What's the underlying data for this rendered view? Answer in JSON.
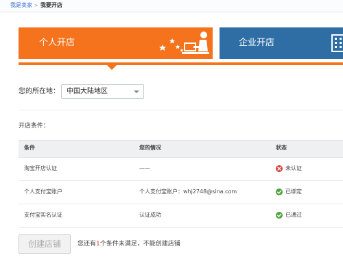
{
  "breadcrumb": {
    "parent": "我是卖家",
    "separator": ">",
    "current": "我要开店"
  },
  "tabs": [
    {
      "label": "个人开店",
      "selected": true,
      "color": "#f5731c",
      "icon": "person-at-desk-icon"
    },
    {
      "label": "企业开店",
      "selected": false,
      "color": "#2f6ea5",
      "icon": "building-icon"
    }
  ],
  "location": {
    "label": "您的所在地：",
    "selected": "中国大陆地区"
  },
  "conditions": {
    "title": "开店条件：",
    "headers": [
      "条件",
      "您的情况",
      "状态"
    ],
    "rows": [
      {
        "condition": "淘宝开店认证",
        "situation": "——",
        "status": "未认证",
        "status_type": "error"
      },
      {
        "condition": "个人支付宝账户",
        "situation": "个人支付宝账户：whj2748@sina.com",
        "status": "已绑定",
        "status_type": "ok"
      },
      {
        "condition": "支付宝实名认证",
        "situation": "认证成功",
        "status": "已通过",
        "status_type": "ok"
      }
    ]
  },
  "actions": {
    "create_store": "创建店铺",
    "notice_before": "您还有",
    "notice_count": "1",
    "notice_after": "个条件未满足，不能创建店铺"
  },
  "colors": {
    "accent_orange": "#f5731c",
    "accent_blue": "#2f6ea5",
    "error_red": "#d9413a",
    "ok_green": "#4ea43b"
  }
}
